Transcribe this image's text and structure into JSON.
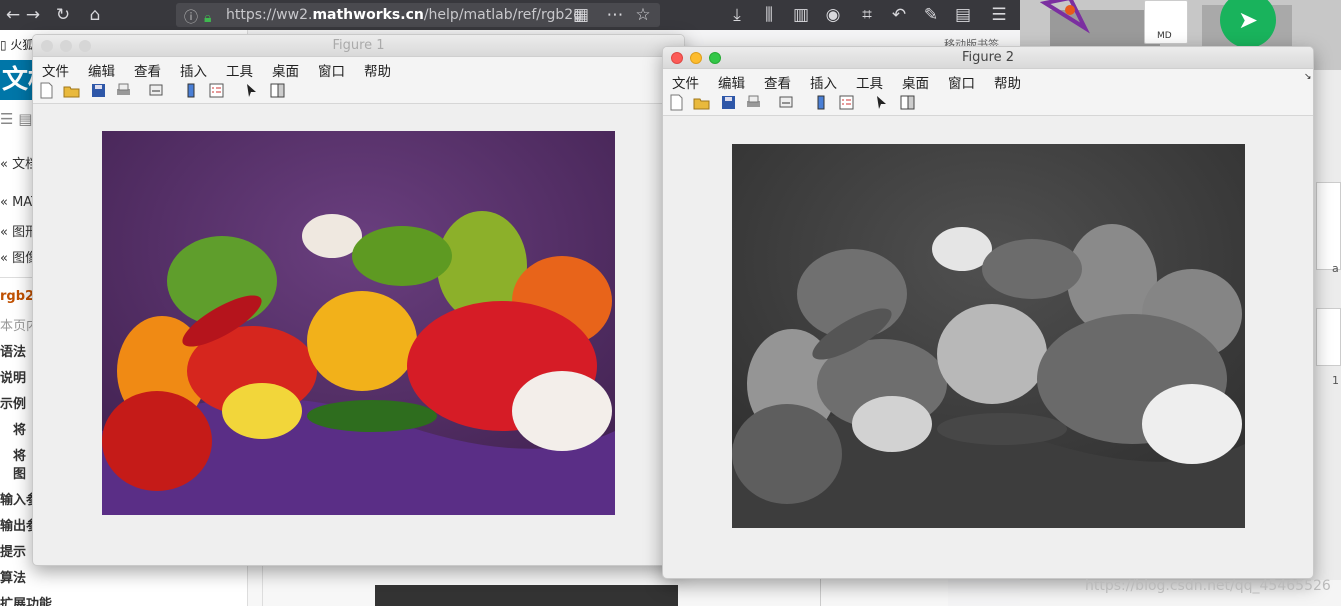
{
  "browser": {
    "url_prefix": "https://ww2.",
    "url_domain": "mathworks.cn",
    "url_rest": "/help/matlab/ref/rgb2g",
    "bookmark_text": "移动版书签"
  },
  "sidebar": {
    "top_label": "火狐",
    "title": "文档",
    "items": [
      {
        "label": "« 文档"
      },
      {
        "label": "« MAT"
      },
      {
        "label": "« 图形"
      },
      {
        "label": "« 图像"
      },
      {
        "label": "rgb2g"
      },
      {
        "label": "本页内"
      },
      {
        "label": "语法"
      },
      {
        "label": "说明"
      },
      {
        "label": "示例"
      },
      {
        "label": "将"
      },
      {
        "label": "将"
      },
      {
        "label": "图"
      },
      {
        "label": "输入参"
      },
      {
        "label": "输出参"
      },
      {
        "label": "提示"
      },
      {
        "label": "算法"
      },
      {
        "label": "扩展功能"
      }
    ]
  },
  "desktop": {
    "md_label": "MD",
    "side_letter_1": "a",
    "side_letter_2": "1"
  },
  "figure1": {
    "title": "Figure 1",
    "menu": [
      "文件",
      "编辑",
      "查看",
      "插入",
      "工具",
      "桌面",
      "窗口",
      "帮助"
    ]
  },
  "figure2": {
    "title": "Figure 2",
    "menu": [
      "文件",
      "编辑",
      "查看",
      "插入",
      "工具",
      "桌面",
      "窗口",
      "帮助"
    ]
  },
  "toolbar_icons": [
    "new-figure-icon",
    "open-file-icon",
    "save-icon",
    "print-icon",
    "link-icon",
    "colorbar-icon",
    "legend-icon",
    "pointer-icon",
    "property-editor-icon"
  ],
  "watermark": "https://blog.csdn.net/qq_45465526"
}
